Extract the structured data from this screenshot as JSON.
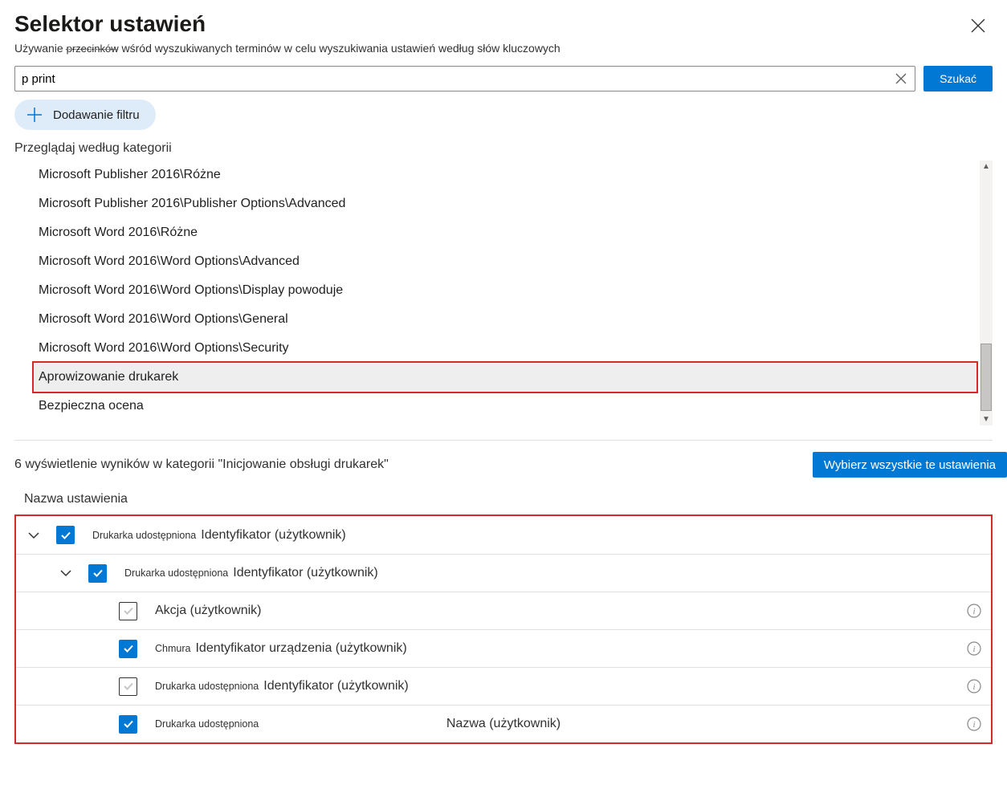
{
  "dialog": {
    "title": "Selektor ustawień",
    "subtitle_prefix": "Używanie ",
    "subtitle_commas": "przecinków",
    "subtitle_rest": " wśród wyszukiwanych terminów w celu wyszukiwania ustawień według słów kluczowych"
  },
  "search": {
    "value": "p print",
    "button": "Szukać"
  },
  "add_filter": "Dodawanie filtru",
  "browse_label": "Przeglądaj według kategorii",
  "categories": [
    "Microsoft Publisher 2016\\Różne",
    "Microsoft Publisher 2016\\Publisher Options\\Advanced",
    "Microsoft Word 2016\\Różne",
    "Microsoft Word 2016\\Word Options\\Advanced",
    "Microsoft Word 2016\\Word Options\\Display powoduje",
    "Microsoft Word 2016\\Word Options\\General",
    "Microsoft Word 2016\\Word Options\\Security",
    "Aprowizowanie drukarek",
    "Bezpieczna ocena"
  ],
  "selected_category_index": 7,
  "results": {
    "count": "6",
    "text": " wyświetlenie wyników w kategorii \"Inicjowanie obsługi drukarek\"",
    "select_all": "Wybierz wszystkie te ustawienia",
    "column_header": "Nazwa ustawienia"
  },
  "settings": [
    {
      "indent": 0,
      "expanded": true,
      "checked": true,
      "label_small": "Drukarka udostępniona",
      "label": "Identyfikator (użytkownik)",
      "has_info": false
    },
    {
      "indent": 1,
      "expanded": true,
      "checked": true,
      "label_small": "Drukarka udostępniona",
      "label": "Identyfikator (użytkownik)",
      "has_info": false
    },
    {
      "indent": 2,
      "checked": false,
      "label_small": "",
      "label": "Akcja (użytkownik)",
      "has_info": true
    },
    {
      "indent": 2,
      "checked": true,
      "label_small": "Chmura",
      "label": "Identyfikator urządzenia (użytkownik)",
      "has_info": true
    },
    {
      "indent": 2,
      "checked": false,
      "label_small": "Drukarka udostępniona",
      "label": "Identyfikator (użytkownik)",
      "has_info": true
    },
    {
      "indent": 2,
      "checked": true,
      "label_small": "Drukarka udostępniona",
      "label": "",
      "center_label": "Nazwa (użytkownik)",
      "has_info": true
    }
  ]
}
